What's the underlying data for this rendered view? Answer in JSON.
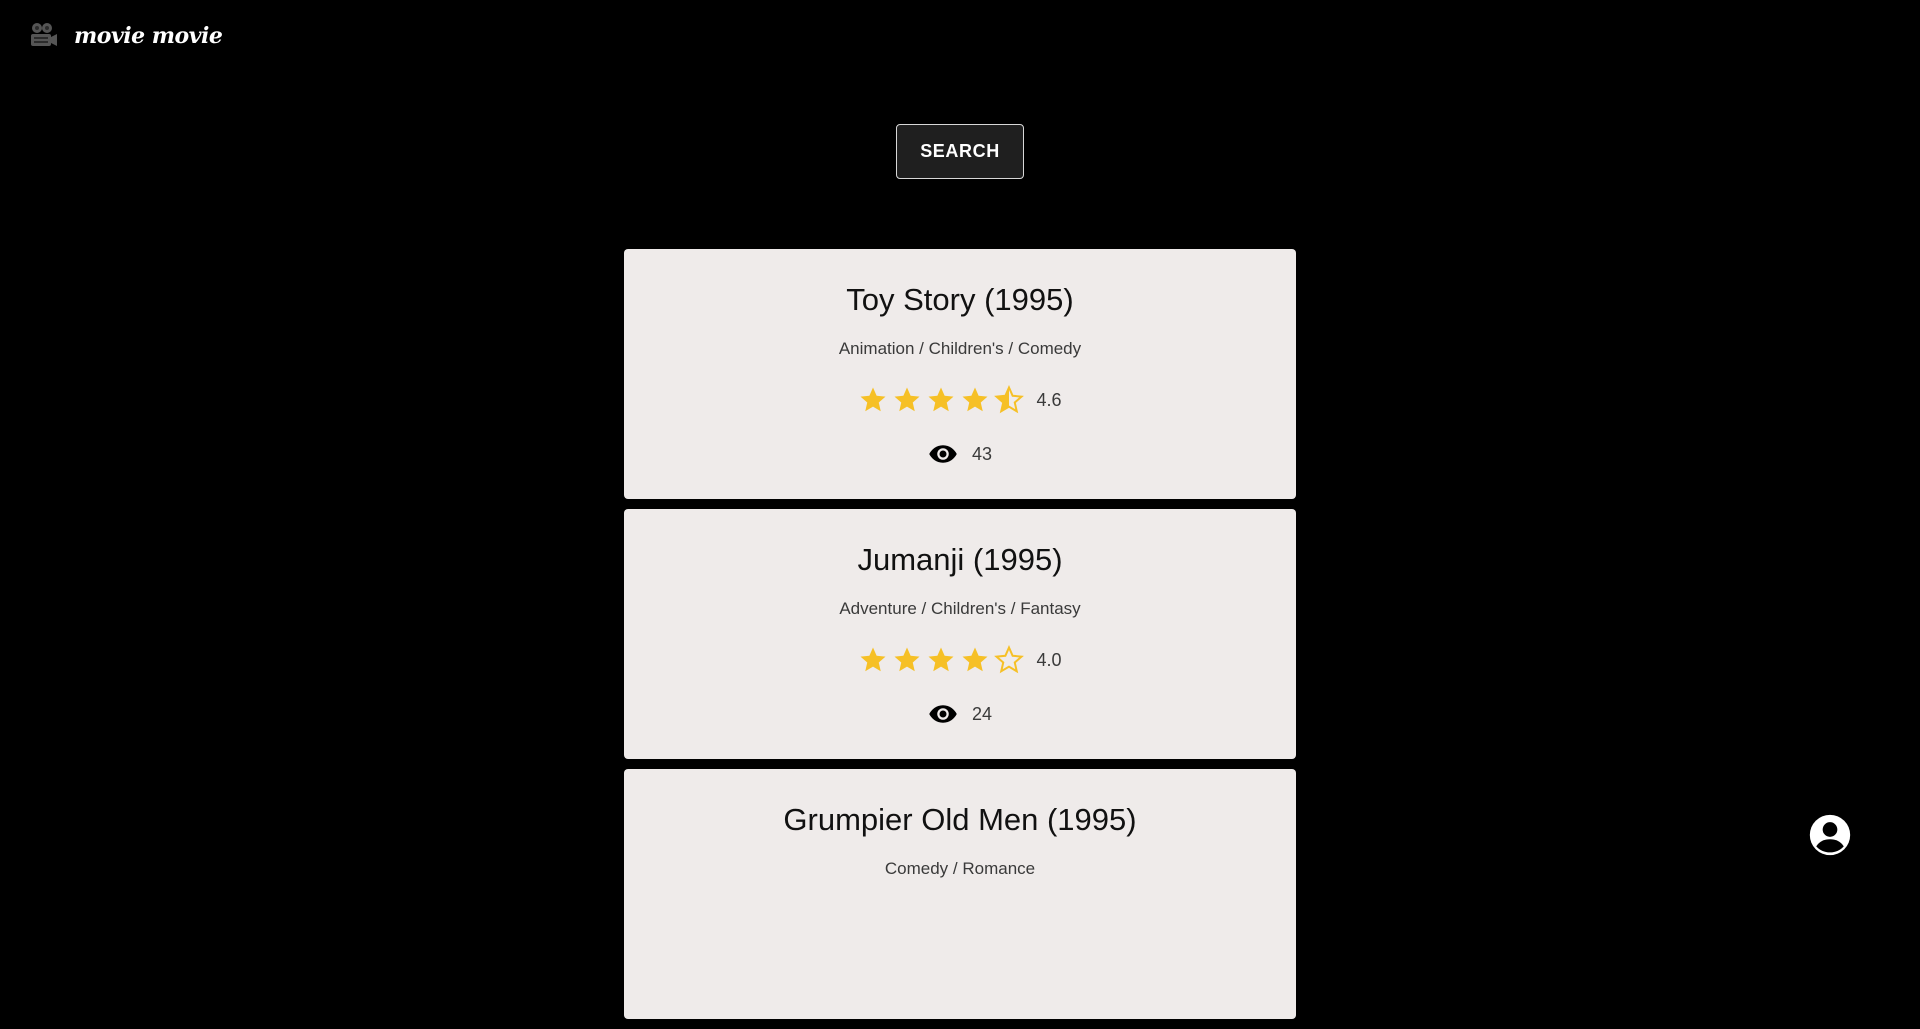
{
  "app": {
    "name": "movie movie",
    "logo_icon": "film-camera-icon"
  },
  "search": {
    "label": "SEARCH"
  },
  "colors": {
    "background": "#000000",
    "card": "#efebea",
    "star": "#f6c026",
    "text": "#111111"
  },
  "movies": [
    {
      "title": "Toy Story (1995)",
      "genres": "Animation / Children's / Comedy",
      "rating": 4.6,
      "rating_label": "4.6",
      "views": "43"
    },
    {
      "title": "Jumanji (1995)",
      "genres": "Adventure / Children's / Fantasy",
      "rating": 4.0,
      "rating_label": "4.0",
      "views": "24"
    },
    {
      "title": "Grumpier Old Men (1995)",
      "genres": "Comedy / Romance",
      "rating": null,
      "rating_label": "",
      "views": ""
    }
  ],
  "account": {
    "icon": "account-circle-icon"
  }
}
